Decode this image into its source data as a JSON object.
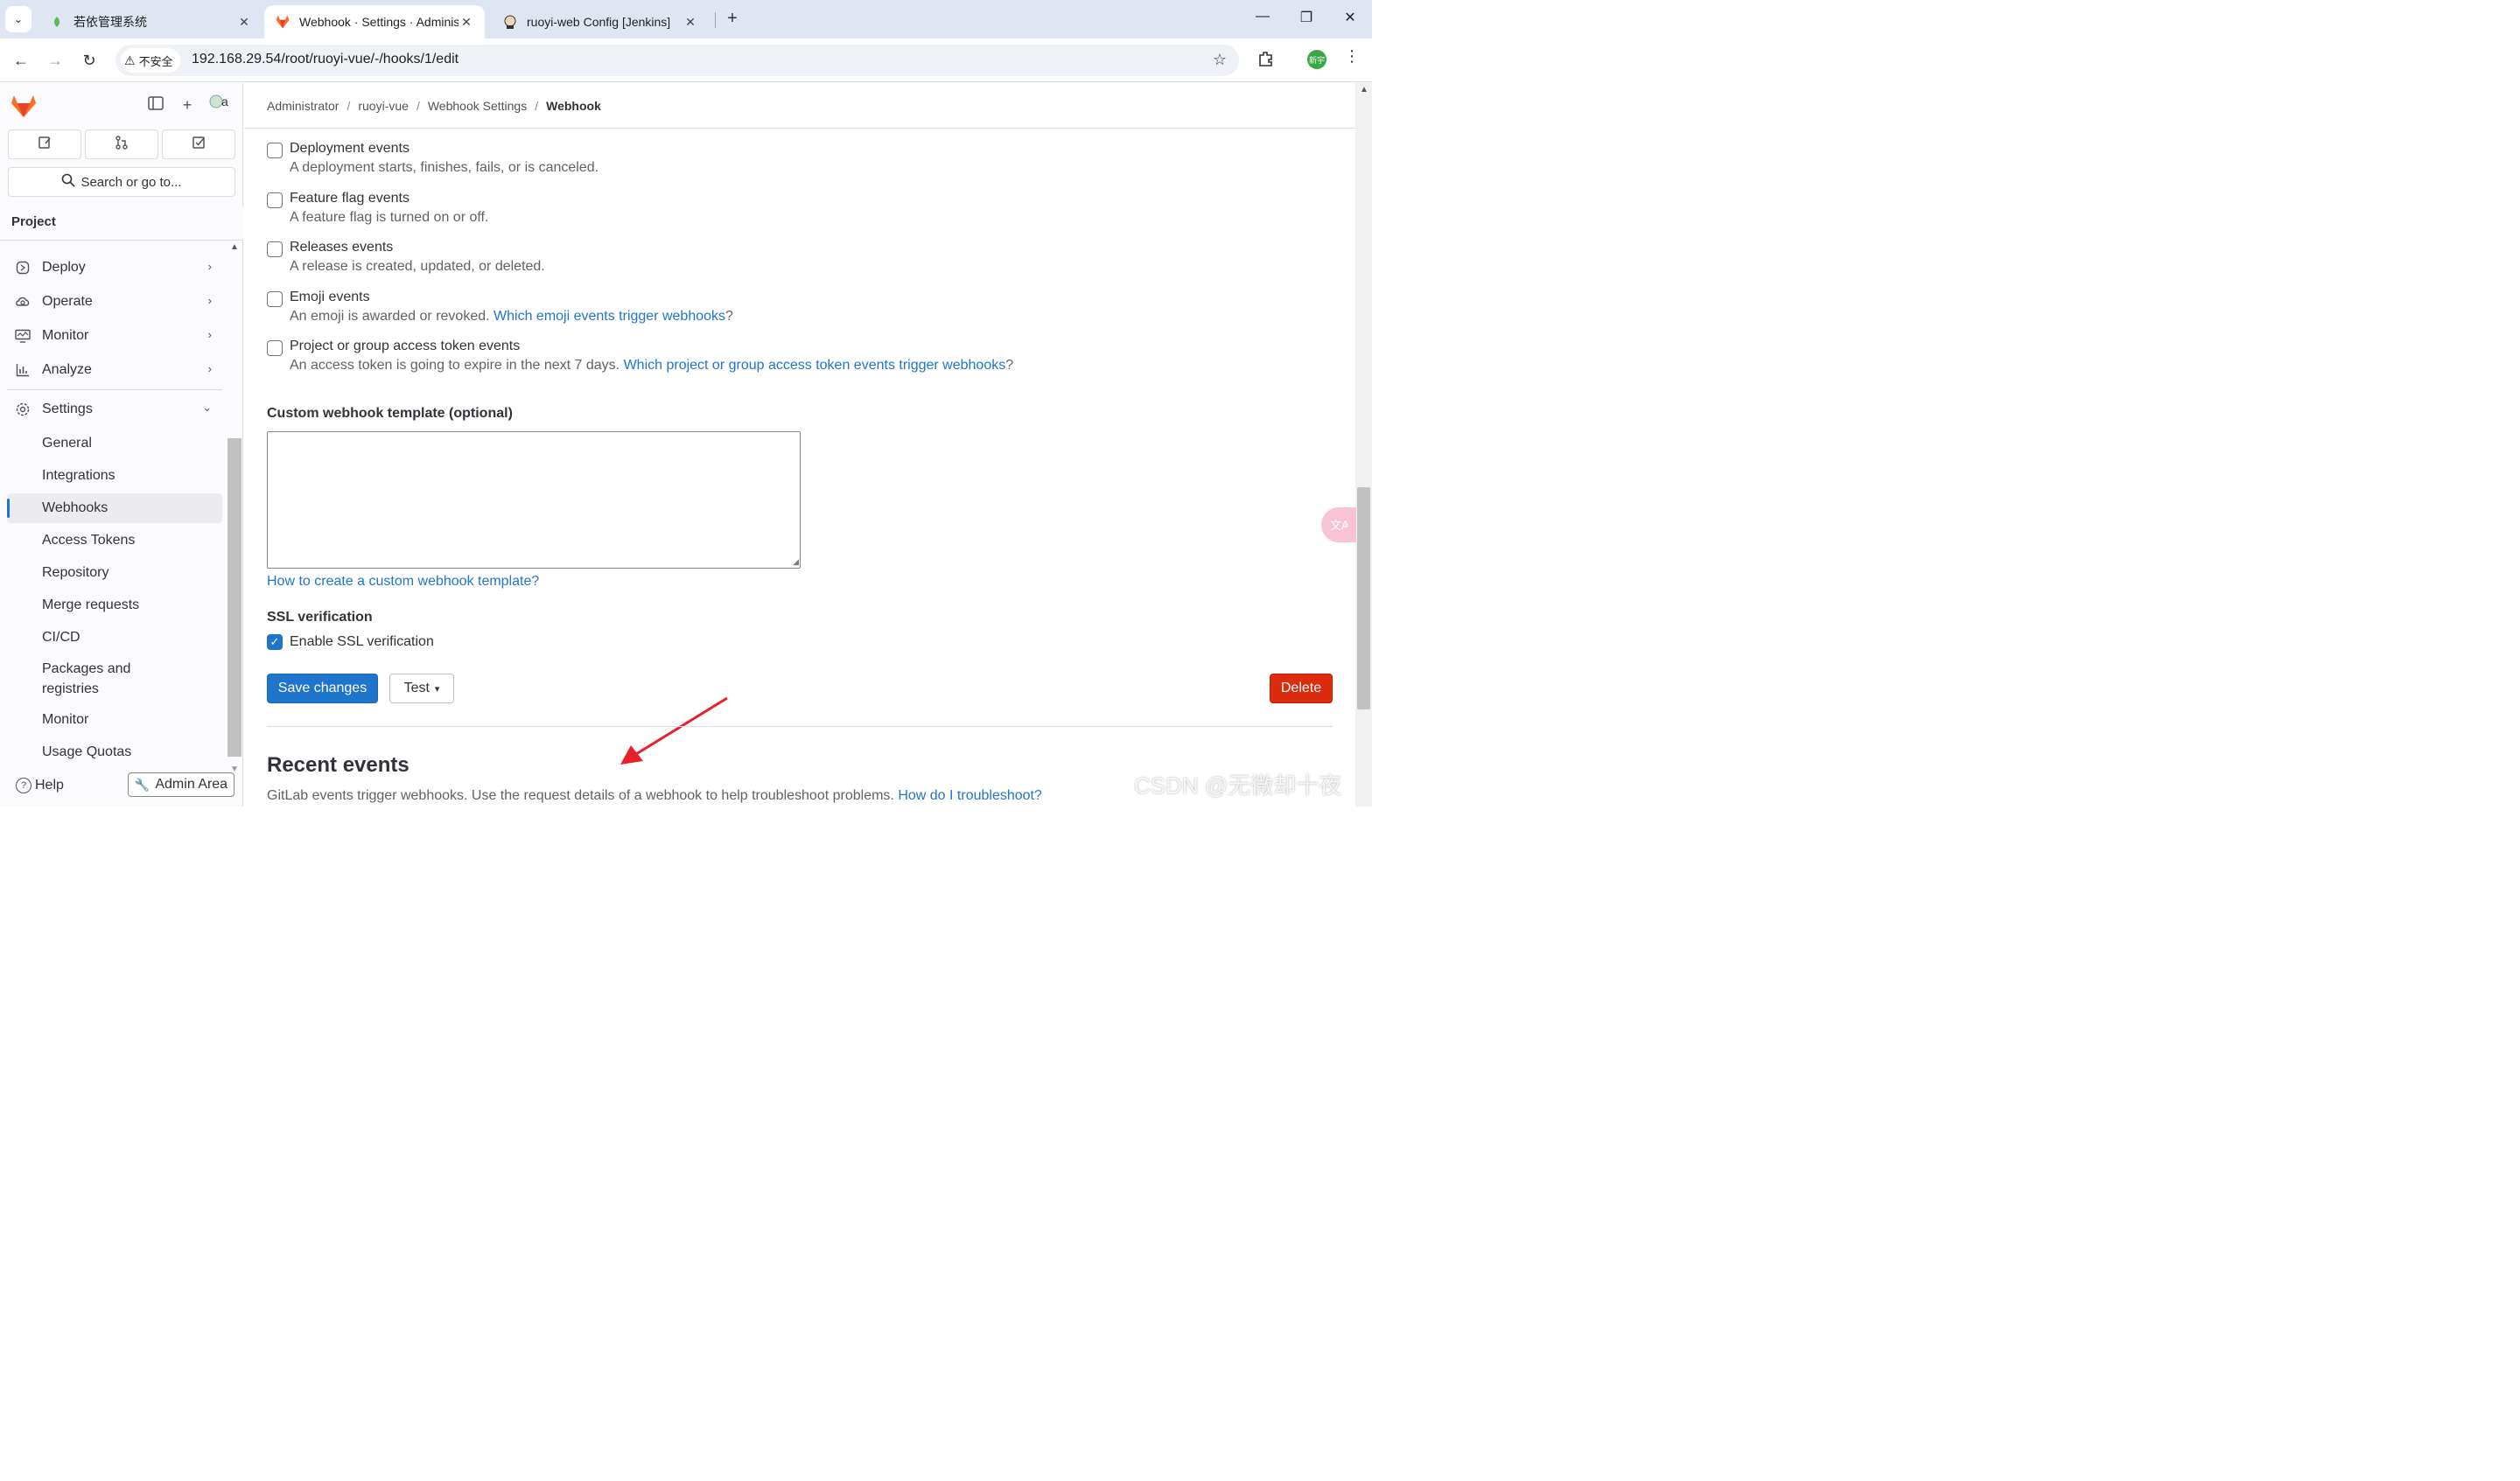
{
  "browser": {
    "tabs": [
      {
        "title": "若依管理系统",
        "active": false
      },
      {
        "title": "Webhook · Settings · Adminis",
        "active": true
      },
      {
        "title": "ruoyi-web Config [Jenkins]",
        "active": false
      }
    ],
    "security_label": "不安全",
    "url": "192.168.29.54/root/ruoyi-vue/-/hooks/1/edit",
    "profile_label": "新宇"
  },
  "sidebar": {
    "search_placeholder": "Search or go to...",
    "section_title": "Project",
    "nav": [
      {
        "label": "Deploy",
        "icon": "deploy-icon"
      },
      {
        "label": "Operate",
        "icon": "operate-icon"
      },
      {
        "label": "Monitor",
        "icon": "monitor-icon"
      },
      {
        "label": "Analyze",
        "icon": "analyze-icon"
      },
      {
        "label": "Settings",
        "icon": "settings-icon",
        "expanded": true
      }
    ],
    "settings_items": [
      "General",
      "Integrations",
      "Webhooks",
      "Access Tokens",
      "Repository",
      "Merge requests",
      "CI/CD",
      "Packages and registries",
      "Monitor",
      "Usage Quotas"
    ],
    "active_item": "Webhooks",
    "help_label": "Help",
    "admin_label": "Admin Area"
  },
  "breadcrumb": [
    "Administrator",
    "ruoyi-vue",
    "Webhook Settings",
    "Webhook"
  ],
  "events": [
    {
      "label": "Deployment events",
      "desc": "A deployment starts, finishes, fails, or is canceled.",
      "checked": false
    },
    {
      "label": "Feature flag events",
      "desc": "A feature flag is turned on or off.",
      "checked": false
    },
    {
      "label": "Releases events",
      "desc": "A release is created, updated, or deleted.",
      "checked": false
    },
    {
      "label": "Emoji events",
      "desc": "An emoji is awarded or revoked.",
      "link": "Which emoji events trigger webhooks",
      "suffix": "?",
      "checked": false
    },
    {
      "label": "Project or group access token events",
      "desc": "An access token is going to expire in the next 7 days.",
      "link": "Which project or group access token events trigger webhooks",
      "suffix": "?",
      "checked": false
    }
  ],
  "template": {
    "label": "Custom webhook template (optional)",
    "value": "",
    "help_link": "How to create a custom webhook template?"
  },
  "ssl": {
    "title": "SSL verification",
    "checkbox_label": "Enable SSL verification",
    "checked": true
  },
  "actions": {
    "save": "Save changes",
    "test": "Test",
    "delete": "Delete"
  },
  "recent": {
    "title": "Recent events",
    "desc": "GitLab events trigger webhooks. Use the request details of a webhook to help troubleshoot problems.",
    "link": "How do I troubleshoot?"
  },
  "watermark": "CSDN @无微却十夜",
  "colors": {
    "primary": "#1f75cb",
    "danger": "#dd2b0e",
    "link": "#1f75cb",
    "annotation_arrow": "#e8202a"
  }
}
